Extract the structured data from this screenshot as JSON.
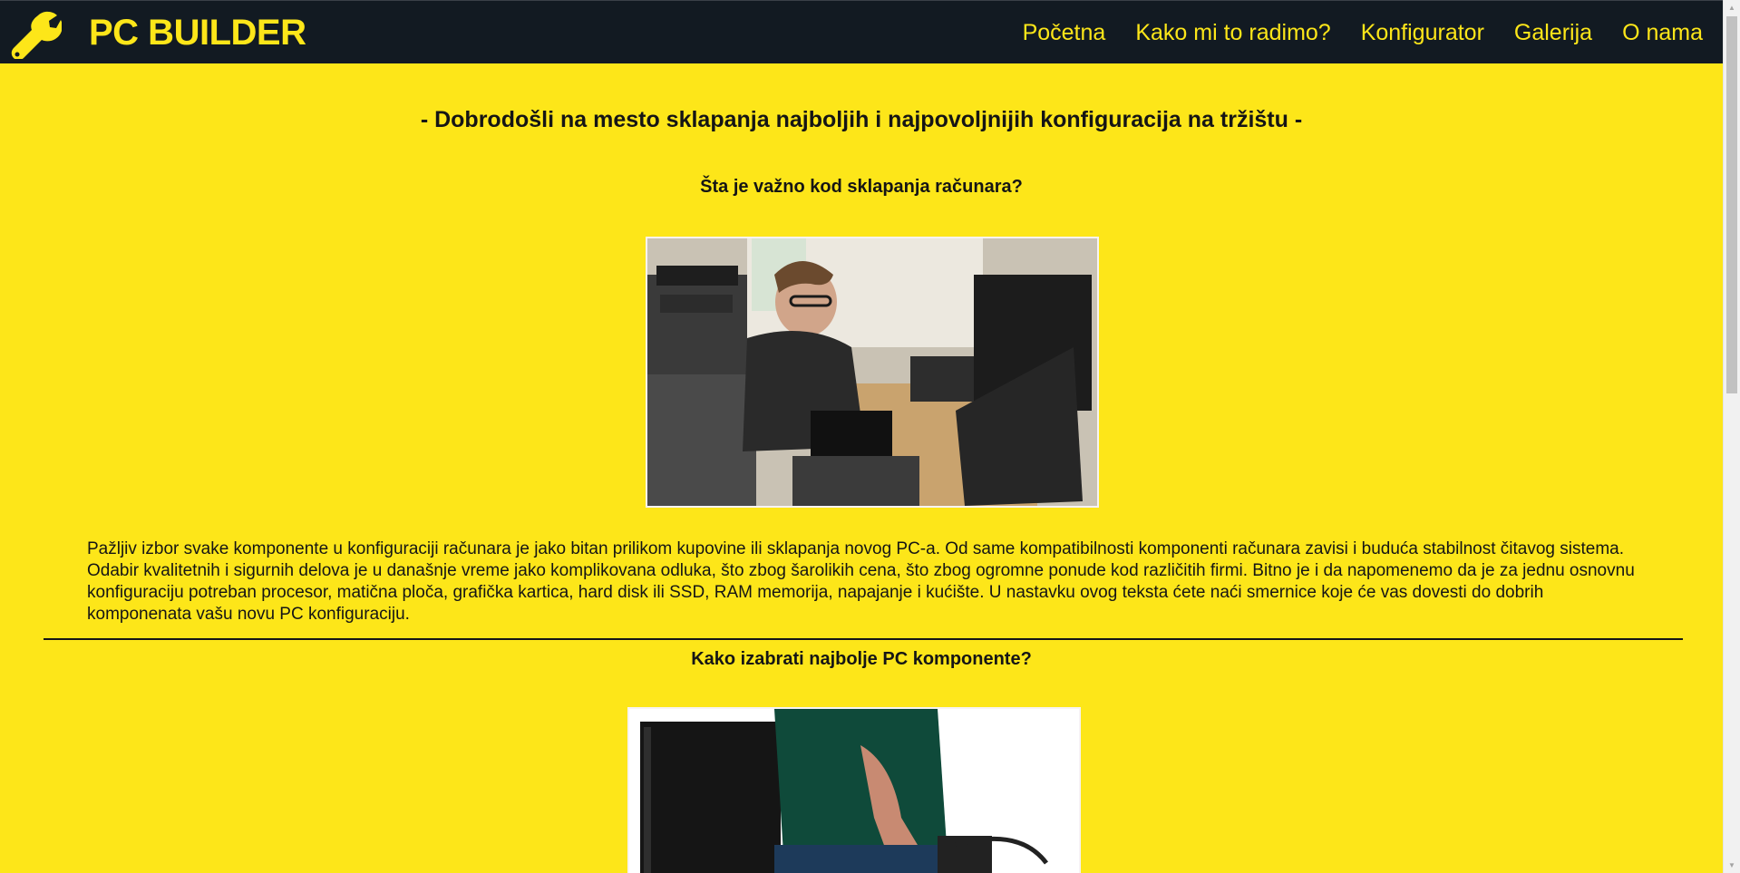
{
  "header": {
    "brand": "PC BUILDER",
    "logo_icon": "wrench-icon",
    "nav": [
      {
        "label": "Početna"
      },
      {
        "label": "Kako mi to radimo?"
      },
      {
        "label": "Konfigurator"
      },
      {
        "label": "Galerija"
      },
      {
        "label": "O nama"
      }
    ]
  },
  "main": {
    "welcome": "- Dobrodošli na mesto sklapanja najboljih i najpovoljnijih konfiguracija na tržištu -",
    "section1_heading": "Šta je važno kod sklapanja računara?",
    "section1_image": "photo-man-building-pc",
    "intro_text": "Pažljiv izbor svake komponente u konfiguraciji računara je jako bitan prilikom kupovine ili sklapanja novog PC-a. Od same kompatibilnosti komponenti računara zavisi i buduća stabilnost čitavog sistema. Odabir kvalitetnih i sigurnih delova je u današnje vreme jako komplikovana odluka, što zbog šarolikih cena, što zbog ogromne ponude kod različitih firmi. Bitno je i da napomenemo da je za jednu osnovnu konfiguraciju potreban procesor, matična ploča, grafička kartica, hard disk ili SSD, RAM memorija, napajanje i kućište. U nastavku ovog teksta ćete naći smernice koje će vas dovesti do dobrih komponenata vašu novu PC konfiguraciju.",
    "section2_heading": "Kako izabrati najbolje PC komponente?",
    "section2_image": "photo-pc-case-assembly"
  },
  "colors": {
    "background": "#fde619",
    "navbar": "#121a22",
    "accent": "#fde619",
    "text": "#151515"
  }
}
